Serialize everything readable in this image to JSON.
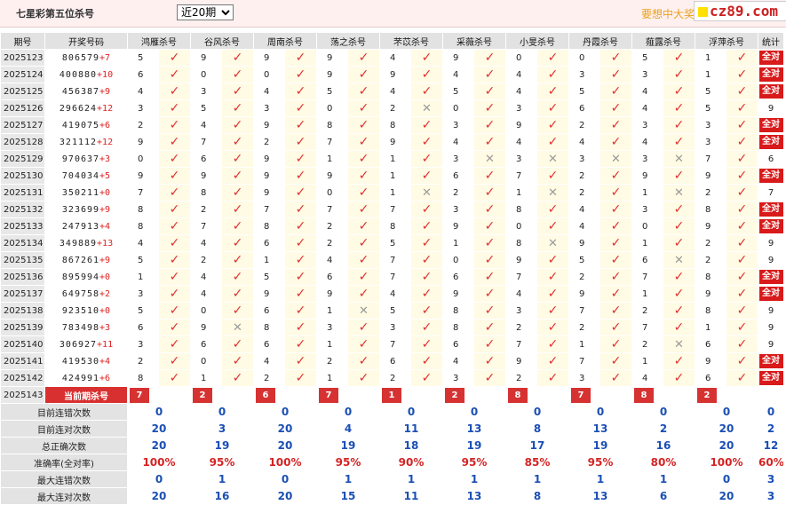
{
  "header": {
    "title": "七星彩第五位杀号",
    "select_value": "近20期",
    "select_options": [
      "近20期"
    ],
    "promo": "要想中大奖",
    "brand": "cz89.com"
  },
  "columns": {
    "period": "期号",
    "draw": "开奖号码",
    "experts": [
      "鸿雁杀号",
      "谷风杀号",
      "周南杀号",
      "荡之杀号",
      "芣苡杀号",
      "采薇杀号",
      "小旻杀号",
      "丹霞杀号",
      "薤露杀号",
      "浮萍杀号"
    ],
    "stat": "统计"
  },
  "rows": [
    {
      "period": "2025123",
      "digits": "806579",
      "suffix": "+7",
      "kills": [
        5,
        9,
        9,
        9,
        4,
        9,
        0,
        0,
        5,
        1
      ],
      "hits": [
        1,
        1,
        1,
        1,
        1,
        1,
        1,
        1,
        1,
        1
      ],
      "stat": "全对"
    },
    {
      "period": "2025124",
      "digits": "400880",
      "suffix": "+10",
      "kills": [
        6,
        0,
        0,
        9,
        9,
        4,
        4,
        3,
        3,
        1
      ],
      "hits": [
        1,
        1,
        1,
        1,
        1,
        1,
        1,
        1,
        1,
        1
      ],
      "stat": "全对"
    },
    {
      "period": "2025125",
      "digits": "456387",
      "suffix": "+9",
      "kills": [
        4,
        3,
        4,
        5,
        4,
        5,
        4,
        5,
        4,
        5
      ],
      "hits": [
        1,
        1,
        1,
        1,
        1,
        1,
        1,
        1,
        1,
        1
      ],
      "stat": "全对"
    },
    {
      "period": "2025126",
      "digits": "296624",
      "suffix": "+12",
      "kills": [
        3,
        5,
        3,
        0,
        2,
        0,
        3,
        6,
        4,
        5
      ],
      "hits": [
        1,
        1,
        1,
        1,
        0,
        1,
        1,
        1,
        1,
        1
      ],
      "stat": "9"
    },
    {
      "period": "2025127",
      "digits": "419075",
      "suffix": "+6",
      "kills": [
        2,
        4,
        9,
        8,
        8,
        3,
        9,
        2,
        3,
        3
      ],
      "hits": [
        1,
        1,
        1,
        1,
        1,
        1,
        1,
        1,
        1,
        1
      ],
      "stat": "全对"
    },
    {
      "period": "2025128",
      "digits": "321112",
      "suffix": "+12",
      "kills": [
        9,
        7,
        2,
        7,
        9,
        4,
        4,
        4,
        4,
        3
      ],
      "hits": [
        1,
        1,
        1,
        1,
        1,
        1,
        1,
        1,
        1,
        1
      ],
      "stat": "全对"
    },
    {
      "period": "2025129",
      "digits": "970637",
      "suffix": "+3",
      "kills": [
        0,
        6,
        9,
        1,
        1,
        3,
        3,
        3,
        3,
        7
      ],
      "hits": [
        1,
        1,
        1,
        1,
        1,
        0,
        0,
        0,
        0,
        1
      ],
      "stat": "6"
    },
    {
      "period": "2025130",
      "digits": "704034",
      "suffix": "+5",
      "kills": [
        9,
        9,
        9,
        9,
        1,
        6,
        7,
        2,
        9,
        9
      ],
      "hits": [
        1,
        1,
        1,
        1,
        1,
        1,
        1,
        1,
        1,
        1
      ],
      "stat": "全对"
    },
    {
      "period": "2025131",
      "digits": "350211",
      "suffix": "+0",
      "kills": [
        7,
        8,
        9,
        0,
        1,
        2,
        1,
        2,
        1,
        2
      ],
      "hits": [
        1,
        1,
        1,
        1,
        0,
        1,
        0,
        1,
        0,
        1
      ],
      "stat": "7"
    },
    {
      "period": "2025132",
      "digits": "323699",
      "suffix": "+9",
      "kills": [
        8,
        2,
        7,
        7,
        7,
        3,
        8,
        4,
        3,
        8
      ],
      "hits": [
        1,
        1,
        1,
        1,
        1,
        1,
        1,
        1,
        1,
        1
      ],
      "stat": "全对"
    },
    {
      "period": "2025133",
      "digits": "247913",
      "suffix": "+4",
      "kills": [
        8,
        7,
        8,
        2,
        8,
        9,
        0,
        4,
        0,
        9
      ],
      "hits": [
        1,
        1,
        1,
        1,
        1,
        1,
        1,
        1,
        1,
        1
      ],
      "stat": "全对"
    },
    {
      "period": "2025134",
      "digits": "349889",
      "suffix": "+13",
      "kills": [
        4,
        4,
        6,
        2,
        5,
        1,
        8,
        9,
        1,
        2
      ],
      "hits": [
        1,
        1,
        1,
        1,
        1,
        1,
        0,
        1,
        1,
        1
      ],
      "stat": "9"
    },
    {
      "period": "2025135",
      "digits": "867261",
      "suffix": "+9",
      "kills": [
        5,
        2,
        1,
        4,
        7,
        0,
        9,
        5,
        6,
        2
      ],
      "hits": [
        1,
        1,
        1,
        1,
        1,
        1,
        1,
        1,
        0,
        1
      ],
      "stat": "9"
    },
    {
      "period": "2025136",
      "digits": "895994",
      "suffix": "+0",
      "kills": [
        1,
        4,
        5,
        6,
        7,
        6,
        7,
        2,
        7,
        8
      ],
      "hits": [
        1,
        1,
        1,
        1,
        1,
        1,
        1,
        1,
        1,
        1
      ],
      "stat": "全对"
    },
    {
      "period": "2025137",
      "digits": "649758",
      "suffix": "+2",
      "kills": [
        3,
        4,
        9,
        9,
        4,
        9,
        4,
        9,
        1,
        9
      ],
      "hits": [
        1,
        1,
        1,
        1,
        1,
        1,
        1,
        1,
        1,
        1
      ],
      "stat": "全对"
    },
    {
      "period": "2025138",
      "digits": "923510",
      "suffix": "+0",
      "kills": [
        5,
        0,
        6,
        1,
        5,
        8,
        3,
        7,
        2,
        8
      ],
      "hits": [
        1,
        1,
        1,
        0,
        1,
        1,
        1,
        1,
        1,
        1
      ],
      "stat": "9"
    },
    {
      "period": "2025139",
      "digits": "783498",
      "suffix": "+3",
      "kills": [
        6,
        9,
        8,
        3,
        3,
        8,
        2,
        2,
        7,
        1
      ],
      "hits": [
        1,
        0,
        1,
        1,
        1,
        1,
        1,
        1,
        1,
        1
      ],
      "stat": "9"
    },
    {
      "period": "2025140",
      "digits": "306927",
      "suffix": "+11",
      "kills": [
        3,
        6,
        6,
        1,
        7,
        6,
        7,
        1,
        2,
        6
      ],
      "hits": [
        1,
        1,
        1,
        1,
        1,
        1,
        1,
        1,
        0,
        1
      ],
      "stat": "9"
    },
    {
      "period": "2025141",
      "digits": "419530",
      "suffix": "+4",
      "kills": [
        2,
        0,
        4,
        2,
        6,
        4,
        9,
        7,
        1,
        9
      ],
      "hits": [
        1,
        1,
        1,
        1,
        1,
        1,
        1,
        1,
        1,
        1
      ],
      "stat": "全对"
    },
    {
      "period": "2025142",
      "digits": "424991",
      "suffix": "+6",
      "kills": [
        8,
        1,
        2,
        1,
        2,
        3,
        2,
        3,
        4,
        6
      ],
      "hits": [
        1,
        1,
        1,
        1,
        1,
        1,
        1,
        1,
        1,
        1
      ],
      "stat": "全对"
    }
  ],
  "current": {
    "period": "2025143",
    "label": "当前期杀号",
    "kills": [
      7,
      2,
      6,
      7,
      1,
      2,
      8,
      7,
      8,
      2
    ]
  },
  "summary": [
    {
      "label": "目前连错次数",
      "values": [
        "0",
        "0",
        "0",
        "0",
        "0",
        "0",
        "0",
        "0",
        "0",
        "0",
        "0"
      ]
    },
    {
      "label": "目前连对次数",
      "values": [
        "20",
        "3",
        "20",
        "4",
        "11",
        "13",
        "8",
        "13",
        "2",
        "20",
        "2"
      ]
    },
    {
      "label": "总正确次数",
      "values": [
        "20",
        "19",
        "20",
        "19",
        "18",
        "19",
        "17",
        "19",
        "16",
        "20",
        "12"
      ]
    },
    {
      "label": "准确率(全对率)",
      "values": [
        "100%",
        "95%",
        "100%",
        "95%",
        "90%",
        "95%",
        "85%",
        "95%",
        "80%",
        "100%",
        "60%"
      ],
      "red": true
    },
    {
      "label": "最大连错次数",
      "values": [
        "0",
        "1",
        "0",
        "1",
        "1",
        "1",
        "1",
        "1",
        "1",
        "0",
        "3"
      ]
    },
    {
      "label": "最大连对次数",
      "values": [
        "20",
        "16",
        "20",
        "15",
        "11",
        "13",
        "8",
        "13",
        "6",
        "20",
        "3"
      ]
    }
  ],
  "colors": {
    "accent_red": "#d91a1a",
    "check_red": "#e03030",
    "cross_grey": "#9a9a9a",
    "summary_blue": "#1a4fb5",
    "header_pink": "#fff0f0"
  },
  "icons": {
    "hit": "check-icon",
    "miss": "cross-icon"
  }
}
